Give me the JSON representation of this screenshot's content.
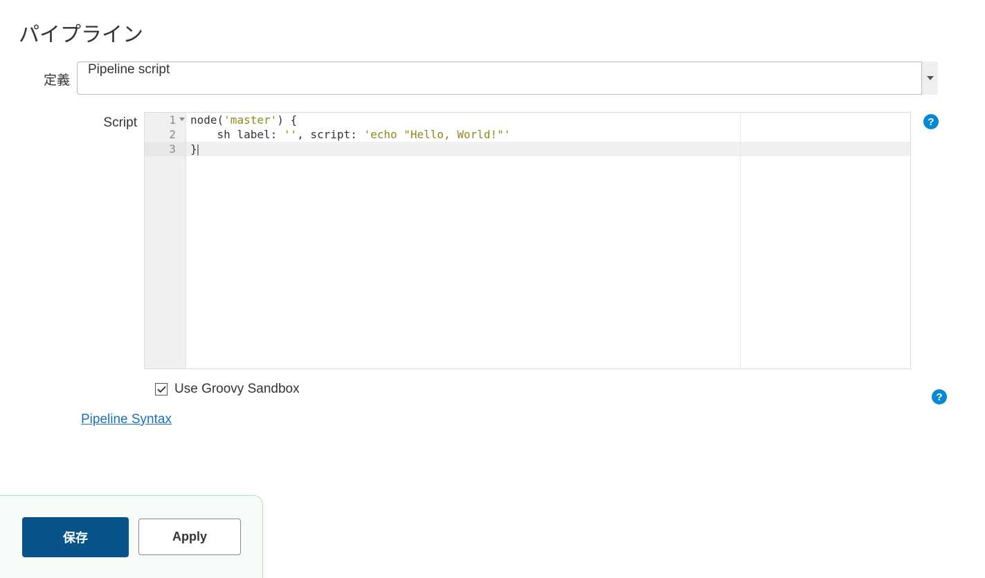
{
  "title": "パイプライン",
  "definition": {
    "label": "定義",
    "selected": "Pipeline script"
  },
  "script": {
    "label": "Script",
    "lines": [
      {
        "num": "1",
        "indent": "",
        "tokens": [
          {
            "t": "fn",
            "v": "node"
          },
          {
            "t": "punc",
            "v": "("
          },
          {
            "t": "str",
            "v": "'master'"
          },
          {
            "t": "punc",
            "v": ") "
          },
          {
            "t": "punc",
            "v": "{"
          }
        ],
        "fold": true
      },
      {
        "num": "2",
        "indent": "    ",
        "tokens": [
          {
            "t": "fn",
            "v": "sh label"
          },
          {
            "t": "punc",
            "v": ": "
          },
          {
            "t": "str",
            "v": "''"
          },
          {
            "t": "punc",
            "v": ", "
          },
          {
            "t": "fn",
            "v": "script"
          },
          {
            "t": "punc",
            "v": ": "
          },
          {
            "t": "str",
            "v": "'echo \"Hello, World!\"'"
          }
        ]
      },
      {
        "num": "3",
        "indent": "",
        "tokens": [
          {
            "t": "punc",
            "v": "}"
          }
        ],
        "active": true
      }
    ]
  },
  "sandbox": {
    "label": "Use Groovy Sandbox",
    "checked": true
  },
  "syntax_link": "Pipeline Syntax",
  "buttons": {
    "save": "保存",
    "apply": "Apply"
  },
  "help_glyph": "?"
}
